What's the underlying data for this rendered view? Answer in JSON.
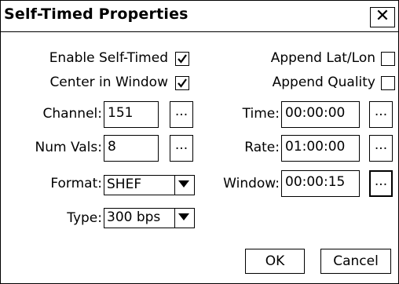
{
  "dialog": {
    "title": "Self-Timed Properties",
    "close_glyph": "✕"
  },
  "checkboxes": {
    "enable_self_timed": {
      "label": "Enable Self-Timed",
      "checked": true
    },
    "center_in_window": {
      "label": "Center in Window",
      "checked": true
    },
    "append_lat_lon": {
      "label": "Append Lat/Lon",
      "checked": false
    },
    "append_quality": {
      "label": "Append Quality",
      "checked": false
    }
  },
  "fields": {
    "channel": {
      "label": "Channel:",
      "value": "151"
    },
    "num_vals": {
      "label": "Num Vals:",
      "value": "8"
    },
    "time": {
      "label": "Time:",
      "value": "00:00:00"
    },
    "rate": {
      "label": "Rate:",
      "value": "01:00:00"
    },
    "window": {
      "label": "Window:",
      "value": "00:00:15"
    }
  },
  "combos": {
    "format": {
      "label": "Format:",
      "value": "SHEF"
    },
    "type": {
      "label": "Type:",
      "value": "300 bps"
    }
  },
  "ellipsis": "...",
  "buttons": {
    "ok": "OK",
    "cancel": "Cancel"
  }
}
